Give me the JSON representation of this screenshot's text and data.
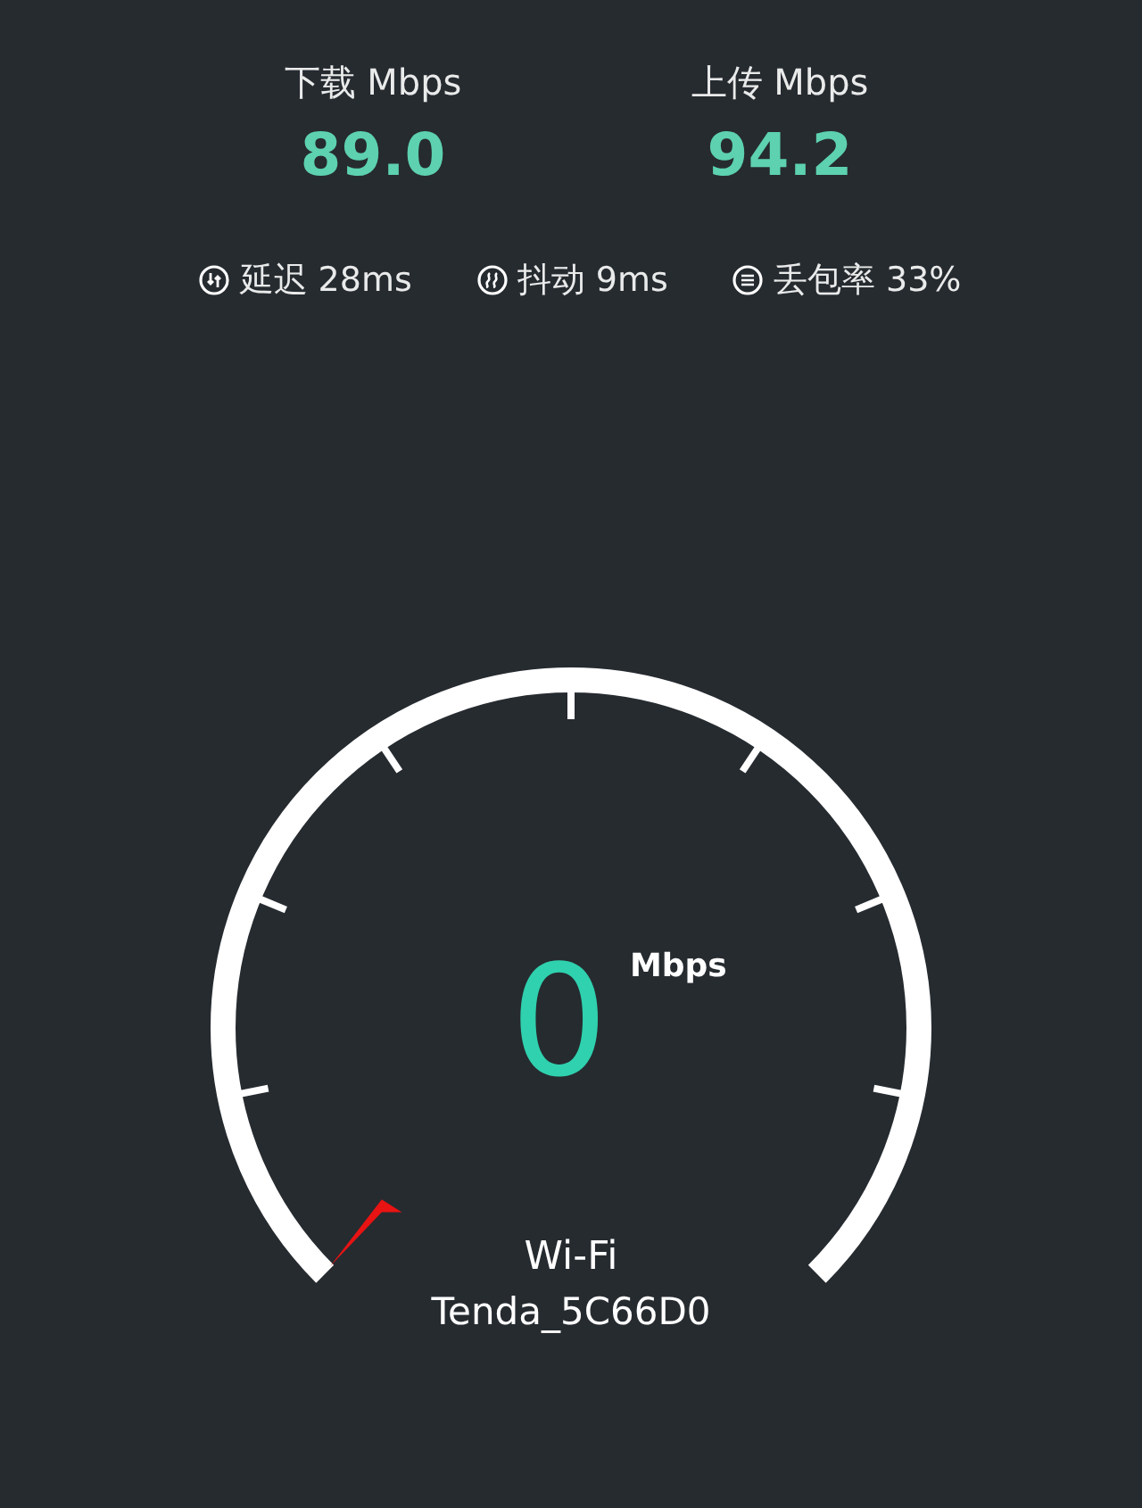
{
  "summary": [
    {
      "label": "下载 Mbps",
      "value": "89.0"
    },
    {
      "label": "上传 Mbps",
      "value": "94.2"
    }
  ],
  "stats": [
    {
      "kind": "latency",
      "text": "延迟 28ms"
    },
    {
      "kind": "jitter",
      "text": "抖动 9ms"
    },
    {
      "kind": "loss",
      "text": "丢包率 33%"
    }
  ],
  "gauge": {
    "reading": "0",
    "unit": "Mbps",
    "network_type": "Wi-Fi",
    "ssid": "Tenda_5C66D0"
  }
}
